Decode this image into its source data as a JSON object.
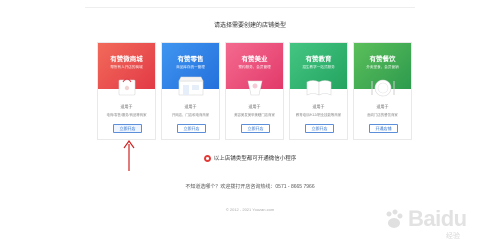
{
  "heading": "请选择需要创建的店铺类型",
  "colors": {
    "card1": "#ea4b4b",
    "card2": "#2d7fe6",
    "card3": "#ea4a78",
    "card4": "#2fb36f",
    "card5": "#3aa75a",
    "button": "#2a6ac8",
    "arrow": "#d02020"
  },
  "cards": [
    {
      "title": "有赞微商城",
      "subtitle": "帮所有人开店的商城",
      "icon": "shop-bag-icon",
      "tag": "适用于",
      "desc": "电商/零售/服务/商品等商家",
      "button": "立即开店"
    },
    {
      "title": "有赞零售",
      "subtitle": "商品库存统一管理",
      "icon": "store-front-icon",
      "tag": "适用于",
      "desc": "开网店、门店和电商商家",
      "button": "立即开店"
    },
    {
      "title": "有赞美业",
      "subtitle": "预约服务，会员管理",
      "icon": "beauty-icon",
      "tag": "适用于",
      "desc": "美容美发美甲美睫门店商家",
      "button": "立即开店"
    },
    {
      "title": "有赞教育",
      "subtitle": "招生教学一站式服务",
      "icon": "book-icon",
      "tag": "适用于",
      "desc": "教育培训/K12/职业技能等商家",
      "button": "立即开店"
    },
    {
      "title": "有赞餐饮",
      "subtitle": "外卖堂食，会员营销",
      "icon": "plate-icon",
      "tag": "适用于",
      "desc": "面向门店的餐饮商家",
      "button": "开通店铺"
    }
  ],
  "note": "以上店铺类型都可开通微信小程序",
  "help": "不知道选哪个？欢迎拨打开店咨询热线：0571 - 8665 7966",
  "copyright": "© 2012 - 2021 Youzan.com",
  "watermark": {
    "brand": "Baidu",
    "sub": "经验"
  }
}
